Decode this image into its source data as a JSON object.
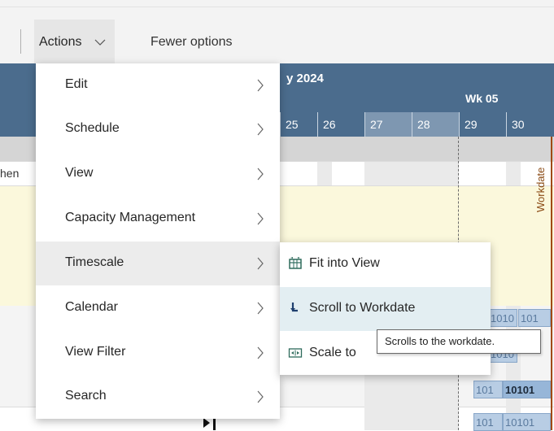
{
  "toolbar": {
    "actions_label": "Actions",
    "fewer_options_label": "Fewer options"
  },
  "gantt": {
    "month_label": "y 2024",
    "week_label": "Wk 05",
    "days": [
      "25",
      "26",
      "27",
      "28",
      "29",
      "30"
    ],
    "row_label": "hen",
    "workdate_label": "Workdate",
    "block_texts": [
      "1010",
      "101",
      "1010",
      "101",
      "10101",
      "101",
      "10101"
    ],
    "colors": {
      "header": "#4b6c8d",
      "weekend": "#7e97b1",
      "workdate_line": "#a04a10",
      "highlight_row": "#fbf8dc"
    }
  },
  "menu": {
    "items": [
      {
        "label": "Edit"
      },
      {
        "label": "Schedule"
      },
      {
        "label": "View"
      },
      {
        "label": "Capacity Management"
      },
      {
        "label": "Timescale"
      },
      {
        "label": "Calendar"
      },
      {
        "label": "View Filter"
      },
      {
        "label": "Search"
      }
    ],
    "active": "Timescale"
  },
  "submenu": {
    "items": [
      {
        "label": "Fit into View",
        "icon": "fit-view-icon"
      },
      {
        "label": "Scroll to Workdate",
        "icon": "arrow-down-right-icon"
      },
      {
        "label": "Scale to",
        "icon": "scale-icon"
      }
    ],
    "active": "Scroll to Workdate"
  },
  "tooltip": {
    "text": "Scrolls to the workdate."
  }
}
